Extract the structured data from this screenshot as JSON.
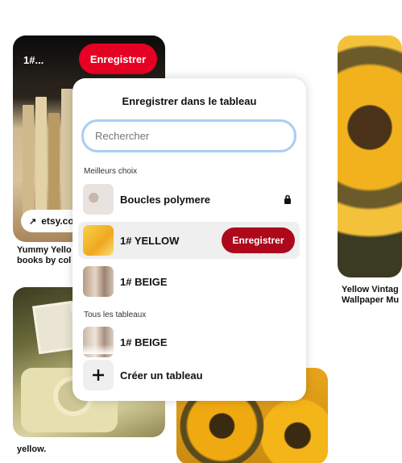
{
  "pins": {
    "books": {
      "board_selector": "1#...",
      "save_label": "Enregistrer",
      "link_domain": "etsy.co",
      "title_line1": "Yummy Yello",
      "title_line2": "books by col"
    },
    "sunflower_right": {
      "title_line1": "Yellow Vintag",
      "title_line2": "Wallpaper Mu"
    },
    "camera": {
      "title": "yellow."
    }
  },
  "popover": {
    "title": "Enregistrer dans le tableau",
    "search_placeholder": "Rechercher",
    "search_value": "",
    "top_picks_label": "Meilleurs choix",
    "top_picks": [
      {
        "name": "Boucles polymere",
        "secret": true,
        "icon": "lock-icon"
      },
      {
        "name": "1# YELLOW",
        "hovered": true,
        "save_label": "Enregistrer"
      },
      {
        "name": "1# BEIGE"
      }
    ],
    "all_boards_label": "Tous les tableaux",
    "all_boards": [
      {
        "name": "1# BEIGE"
      }
    ],
    "create_label": "Créer un tableau",
    "create_icon": "plus-icon"
  },
  "colors": {
    "brand_red": "#e60023",
    "hover_red": "#ad081b",
    "focus_ring": "#a8cdf5"
  }
}
